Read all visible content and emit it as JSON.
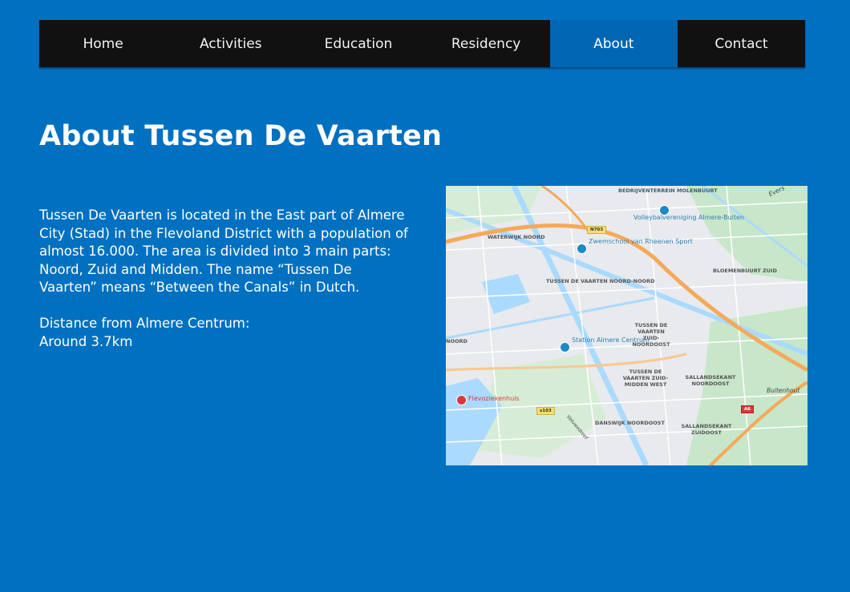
{
  "nav": {
    "items": [
      {
        "label": "Home"
      },
      {
        "label": "Activities"
      },
      {
        "label": "Education"
      },
      {
        "label": "Residency"
      },
      {
        "label": "About"
      },
      {
        "label": "Contact"
      }
    ],
    "active": "About"
  },
  "page": {
    "title": "About Tussen De Vaarten",
    "paragraph1": "Tussen De Vaarten is located in the East part of Almere City (Stad) in the Flevoland District with a population of almost 16.000. The area is divided into 3 main parts: Noord, Zuid and Midden. The name “Tussen De Vaarten” means “Between the Canals” in Dutch.",
    "distance_label": "Distance from Almere Centrum:",
    "distance_value": "Around 3.7km"
  },
  "map": {
    "labels": {
      "bedrijventerrein": "BEDRIJVENTERREIN MOLENBUURT",
      "waterwijk": "WATERWIJK NOORD",
      "volleybal": "Volleybalvereniging Almere-Buiten",
      "zwemschool": "Zwemschool van Rheenen Sport",
      "tdv_noord": "TUSSEN DE VAARTEN NOORD-NOORD",
      "bloemenbuurt": "BLOEMENBUURT ZUID",
      "tdv_zuid_noordoost": "TUSSEN DE VAARTEN ZUID-NOORDOOST",
      "noord_left": "NOORD",
      "station": "Station Almere Centrum",
      "tdv_zuid_midden": "TUSSEN DE VAARTEN ZUID-MIDDEN WEST",
      "sallandsekant_noord": "SALLANDSEKANT NOORDOOST",
      "buitenhout": "Buitenhout",
      "flevoziekenhuis": "Flevoziekenhuis",
      "danswijk": "DANSWIJK NOORDOOST",
      "sallandsekant_zuid": "SALLANDSEKANT ZUIDOOST",
      "everst": "Evers",
      "veluwedreef": "Veluwedreef"
    },
    "shields": {
      "n703": "N703",
      "e103": "s103",
      "a6": "A6"
    },
    "colors": {
      "water": "#aadaff",
      "park": "#c8e6c9",
      "urban": "#e8eaed",
      "highway": "#f5a95a",
      "road": "#ffffff"
    }
  }
}
